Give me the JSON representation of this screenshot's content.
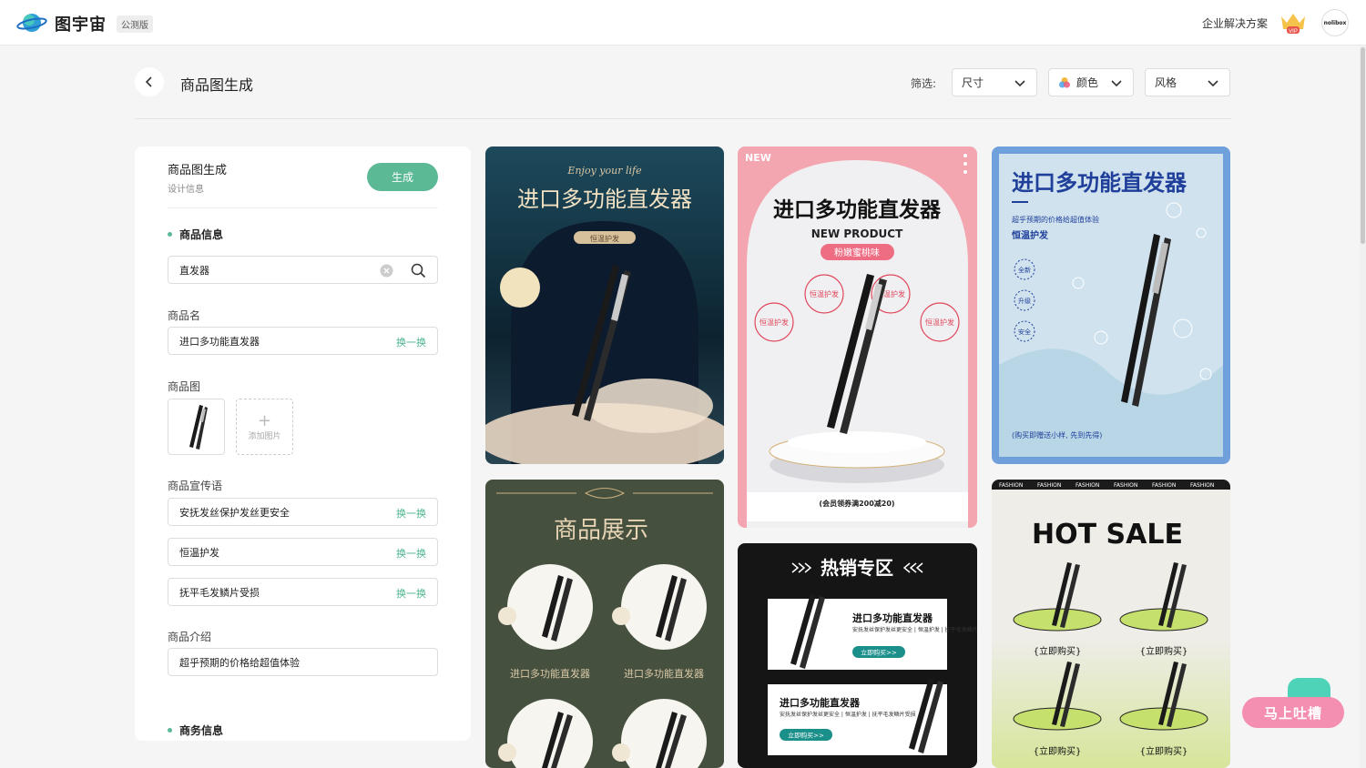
{
  "header": {
    "brand": "图宇宙",
    "beta_badge": "公测版",
    "enterprise_link": "企业解决方案",
    "vip_badge": "VIP",
    "avatar_text": "nolibox"
  },
  "page": {
    "title": "商品图生成",
    "filter_label": "筛选:",
    "filters": [
      {
        "label": "尺寸"
      },
      {
        "label": "颜色"
      },
      {
        "label": "风格"
      }
    ]
  },
  "panel": {
    "title": "商品图生成",
    "subtitle": "设计信息",
    "generate_button": "生成",
    "product_info_section": "商品信息",
    "search_value": "直发器",
    "name_label": "商品名",
    "name_value": "进口多功能直发器",
    "swap_label": "换一换",
    "image_label": "商品图",
    "add_image": "添加图片",
    "slogan_label": "商品宣传语",
    "slogans": [
      "安抚发丝保护发丝更安全",
      "恒温护发",
      "抚平毛发鳞片受损"
    ],
    "intro_label": "商品介绍",
    "intro_value": "超乎预期的价格给超值体验",
    "business_section": "商务信息"
  },
  "templates": {
    "c1": {
      "script": "Enjoy your life",
      "title": "进口多功能直发器",
      "tag": "恒温护发"
    },
    "c2": {
      "badge": "NEW",
      "title": "进口多功能直发器",
      "subtitle": "NEW PRODUCT",
      "pill": "粉嫩蜜桃味",
      "ring": "恒温护发",
      "footer": "(会员领券满200减20)"
    },
    "c3": {
      "title": "进口多功能直发器",
      "desc": "超乎预期的价格给超值体验",
      "sub": "恒温护发",
      "badges": [
        "全新",
        "升级",
        "安全"
      ],
      "footer": "(购买即赠送小样, 先到先得)"
    },
    "c4": {
      "title": "商品展示",
      "item": "进口多功能直发器"
    },
    "c5": {
      "title": "热销专区",
      "product": "进口多功能直发器",
      "desc": "安抚发丝保护发丝更安全 | 恒温护发 | 抚平毛发鳞片受损",
      "buy": "立即购买>>"
    },
    "c6": {
      "strip": "FASHION",
      "title": "HOT SALE",
      "buy": "{立即购买}"
    }
  },
  "feedback": {
    "label": "马上吐槽"
  },
  "colors": {
    "accent": "#5bb996",
    "swap": "#4bb48c",
    "feedback": "#f48fb1"
  }
}
